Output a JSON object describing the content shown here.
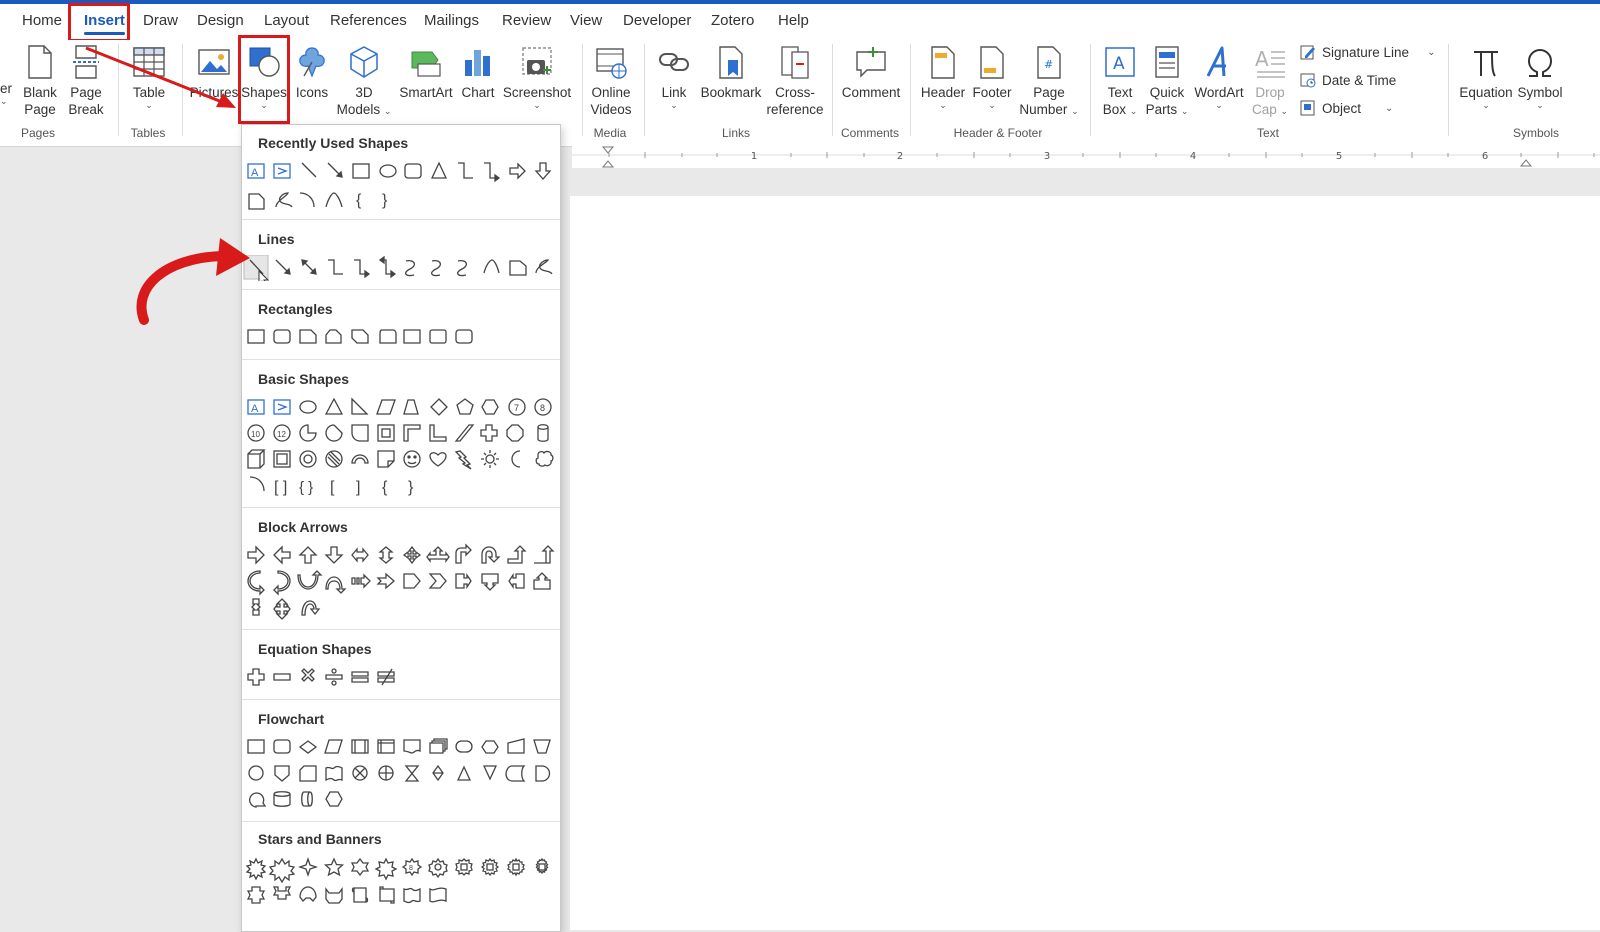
{
  "tabs": [
    {
      "label": "Home",
      "active": false
    },
    {
      "label": "Insert",
      "active": true
    },
    {
      "label": "Draw",
      "active": false
    },
    {
      "label": "Design",
      "active": false
    },
    {
      "label": "Layout",
      "active": false
    },
    {
      "label": "References",
      "active": false
    },
    {
      "label": "Mailings",
      "active": false
    },
    {
      "label": "Review",
      "active": false
    },
    {
      "label": "View",
      "active": false
    },
    {
      "label": "Developer",
      "active": false
    },
    {
      "label": "Zotero",
      "active": false
    },
    {
      "label": "Help",
      "active": false
    }
  ],
  "ribbon": {
    "cut_left_label": "er",
    "blank_page": {
      "line1": "Blank",
      "line2": "Page"
    },
    "page_break": {
      "line1": "Page",
      "line2": "Break"
    },
    "table": "Table",
    "pictures": "Pictures",
    "shapes": "Shapes",
    "icons": "Icons",
    "models3d": {
      "line1": "3D",
      "line2": "Models"
    },
    "smartart": "SmartArt",
    "chart": "Chart",
    "screenshot": "Screenshot",
    "online_videos": {
      "line1": "Online",
      "line2": "Videos"
    },
    "link": "Link",
    "bookmark": "Bookmark",
    "crossref": {
      "line1": "Cross-",
      "line2": "reference"
    },
    "comment": "Comment",
    "header": "Header",
    "footer": "Footer",
    "page_number": {
      "line1": "Page",
      "line2": "Number"
    },
    "text_box": {
      "line1": "Text",
      "line2": "Box"
    },
    "quick_parts": {
      "line1": "Quick",
      "line2": "Parts"
    },
    "wordart": "WordArt",
    "drop_cap": {
      "line1": "Drop",
      "line2": "Cap"
    },
    "signature_line": "Signature Line",
    "date_time": "Date & Time",
    "object": "Object",
    "equation": "Equation",
    "symbol": "Symbol",
    "groups": {
      "pages": "Pages",
      "tables": "Tables",
      "media": "Media",
      "links": "Links",
      "comments": "Comments",
      "header_footer": "Header & Footer",
      "text": "Text",
      "symbols": "Symbols"
    }
  },
  "ruler": {
    "numbers": [
      "1",
      "2",
      "3",
      "4",
      "5",
      "6"
    ]
  },
  "shapes_menu": {
    "sections": [
      {
        "title": "Recently Used Shapes"
      },
      {
        "title": "Lines"
      },
      {
        "title": "Rectangles"
      },
      {
        "title": "Basic Shapes"
      },
      {
        "title": "Block Arrows"
      },
      {
        "title": "Equation Shapes"
      },
      {
        "title": "Flowchart"
      },
      {
        "title": "Stars and Banners"
      }
    ]
  },
  "colors": {
    "accent": "#185abd",
    "annotation": "#d81a1a",
    "icon_blue": "#2f6fcf"
  }
}
